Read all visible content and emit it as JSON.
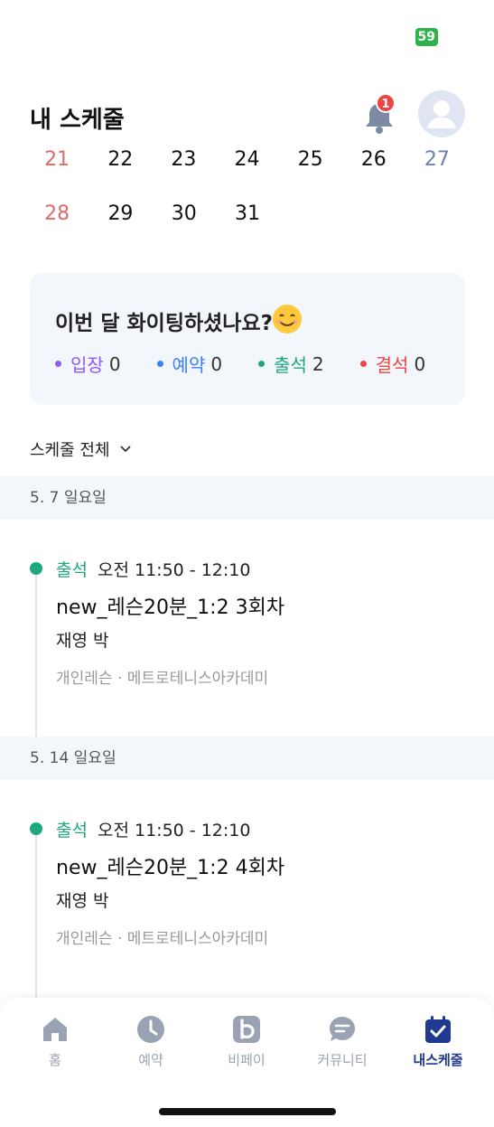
{
  "status_bar": {
    "battery": "59"
  },
  "header": {
    "title": "내 스케줄",
    "notification_count": "1"
  },
  "calendar": {
    "week1": [
      "21",
      "22",
      "23",
      "24",
      "25",
      "26",
      "27"
    ],
    "week2": [
      "28",
      "29",
      "30",
      "31"
    ]
  },
  "summary": {
    "title": "이번 달 화이팅하셨나요?",
    "stats": [
      {
        "label": "입장",
        "count": "0",
        "color": "#8b5cf6"
      },
      {
        "label": "예약",
        "count": "0",
        "color": "#3b82f6"
      },
      {
        "label": "출석",
        "count": "2",
        "color": "#1ea97c"
      },
      {
        "label": "결석",
        "count": "0",
        "color": "#ef4444"
      }
    ]
  },
  "filter": {
    "label": "스케줄 전체"
  },
  "groups": [
    {
      "date": "5. 7 일요일",
      "entry": {
        "status": "출석",
        "time": "오전 11:50 - 12:10",
        "lesson": "new_레슨20분_1:2 3회차",
        "person": "재영 박",
        "meta": "개인레슨 · 메트로테니스아카데미"
      }
    },
    {
      "date": "5. 14 일요일",
      "entry": {
        "status": "출석",
        "time": "오전 11:50 - 12:10",
        "lesson": "new_레슨20분_1:2 4회차",
        "person": "재영 박",
        "meta": "개인레슨 · 메트로테니스아카데미"
      }
    }
  ],
  "tabbar": {
    "tabs": [
      {
        "label": "홈",
        "icon": "home-icon"
      },
      {
        "label": "예약",
        "icon": "clock-icon"
      },
      {
        "label": "비페이",
        "icon": "b-pay-icon"
      },
      {
        "label": "커뮤니티",
        "icon": "chat-icon"
      },
      {
        "label": "내스케줄",
        "icon": "calendar-check-icon"
      }
    ],
    "active": "내스케줄"
  },
  "colors": {
    "accent": "#1f3a8f",
    "attendance": "#1ea97c",
    "sunday": "#e46a6a",
    "saturday": "#6b7fb8"
  }
}
